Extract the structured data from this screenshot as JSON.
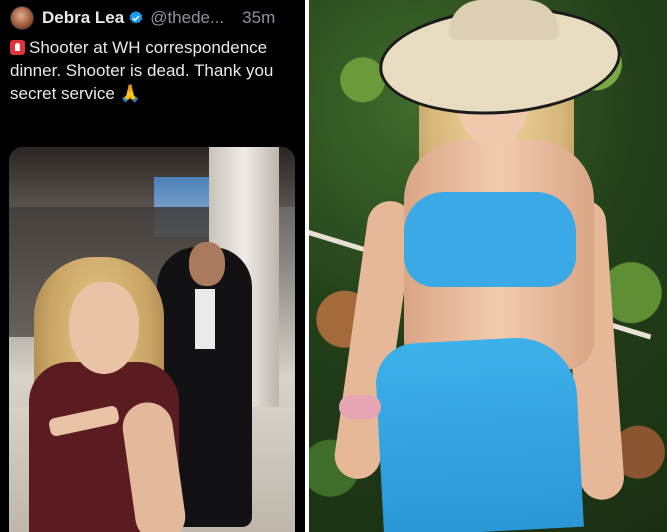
{
  "tweet": {
    "display_name": "Debra Lea",
    "handle": "@thede...",
    "time": "35m",
    "text": "Shooter at WH correspondence dinner. Shooter is dead. Thank you secret service",
    "emoji": "🙏"
  },
  "colors": {
    "verified_badge": "#1d9bf0",
    "text_primary": "#e7e9ea",
    "text_secondary": "#8b949e",
    "siren_red": "#e0333c"
  },
  "icons": {
    "verified": "verified-badge-icon",
    "siren": "siren-icon",
    "praying_hands": "praying-hands-icon"
  }
}
